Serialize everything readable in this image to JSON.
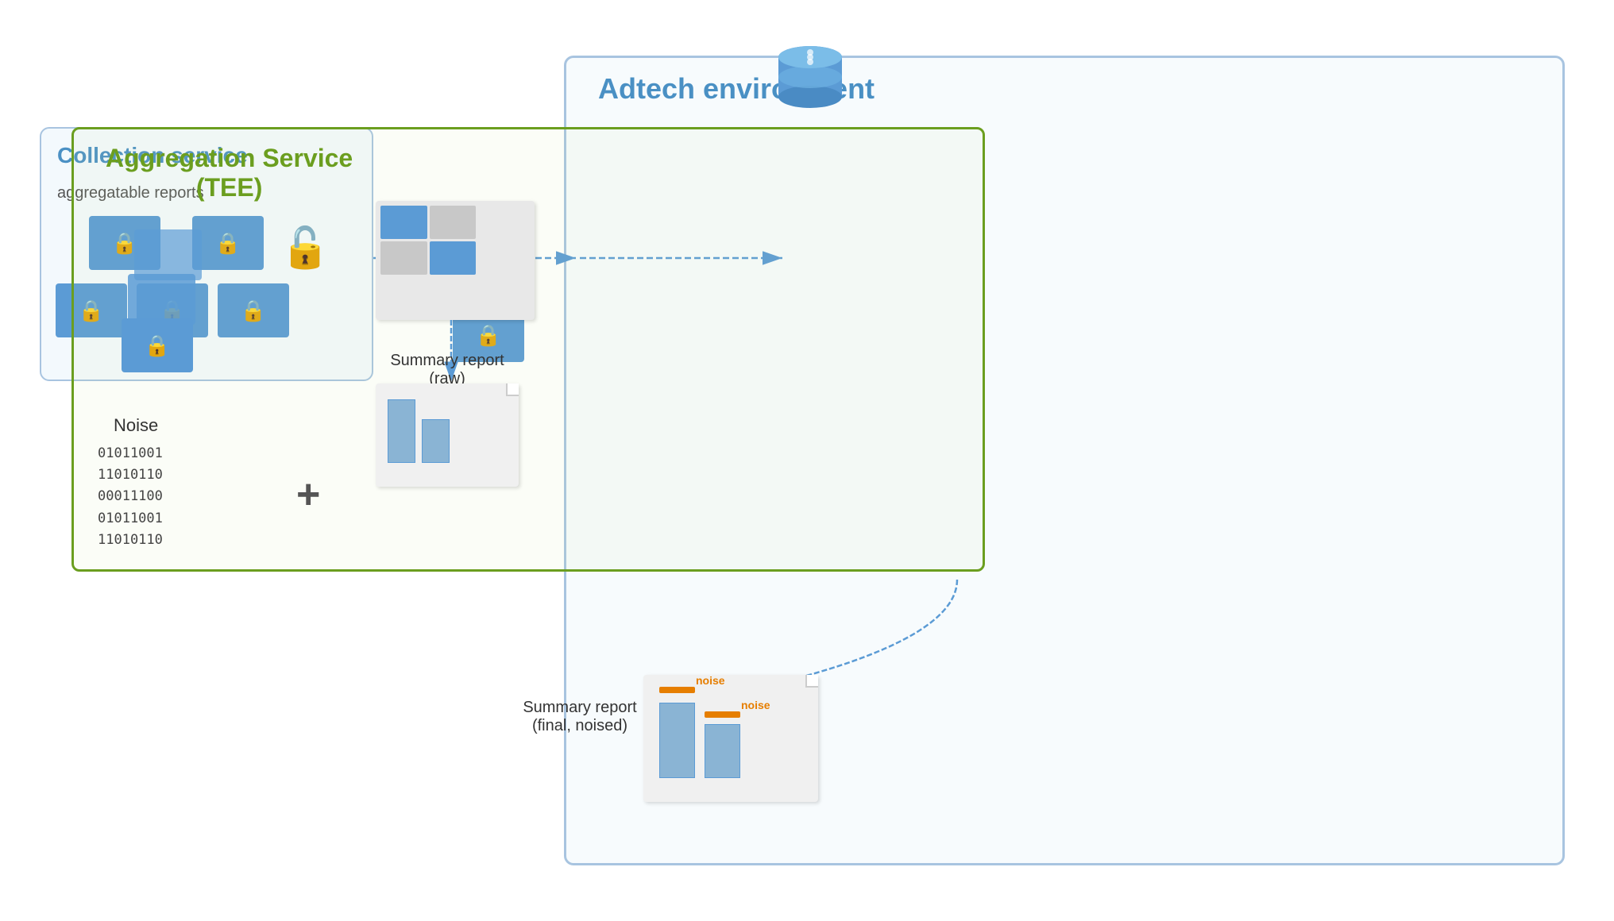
{
  "adtech": {
    "title": "Adtech environment",
    "aggregation_service": {
      "title": "Aggregation Service",
      "subtitle": "(TEE)"
    }
  },
  "collection_service": {
    "title": "Collection service",
    "subtitle": "aggregatable reports"
  },
  "noise": {
    "label": "Noise",
    "binary": [
      "01011001",
      "11010110",
      "00011100",
      "01011001",
      "11010110"
    ]
  },
  "summary_raw": {
    "title": "Summary report",
    "subtitle": "(raw)"
  },
  "summary_final": {
    "title": "Summary report",
    "subtitle": "(final, noised)"
  },
  "noise_annotations": {
    "first": "noise",
    "second": "noise"
  }
}
